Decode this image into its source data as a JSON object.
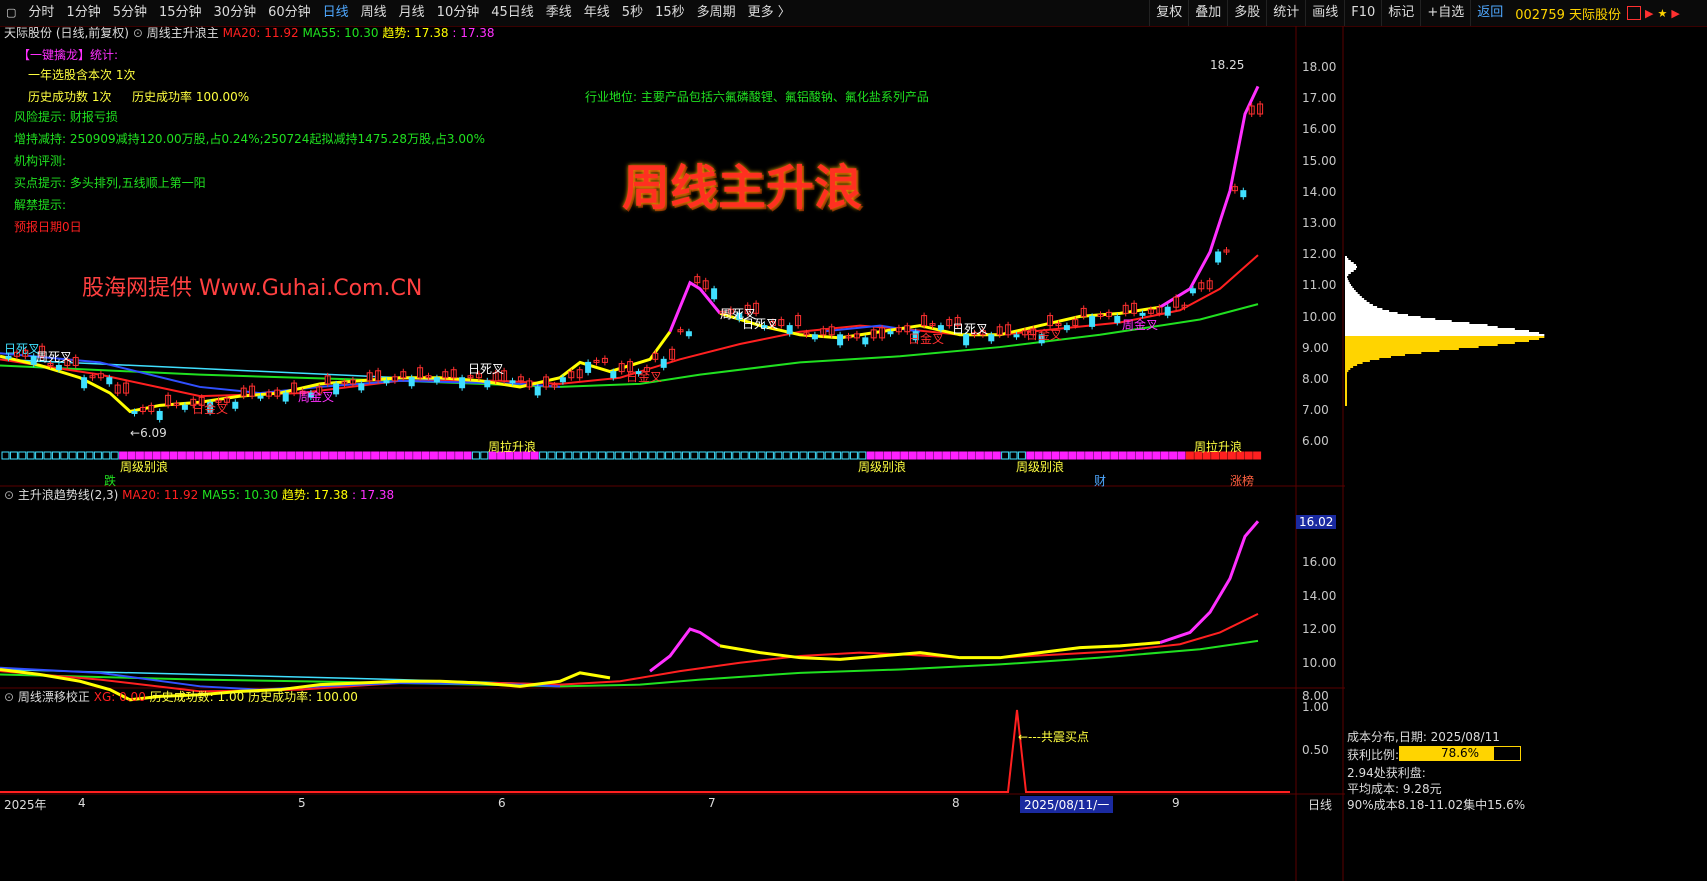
{
  "toolbar": {
    "periods": [
      "分时",
      "1分钟",
      "5分钟",
      "15分钟",
      "30分钟",
      "60分钟",
      "日线",
      "周线",
      "月线",
      "10分钟",
      "45日线",
      "季线",
      "年线",
      "5秒",
      "15秒",
      "多周期",
      "更多 〉"
    ],
    "active_period": "日线",
    "right_buttons": [
      "复权",
      "叠加",
      "多股",
      "统计",
      "画线",
      "F10",
      "标记",
      "+自选",
      "返回"
    ],
    "stock_title": "002759 天际股份"
  },
  "main_panel": {
    "header": {
      "stock": "天际股份 (日线,前复权)",
      "indicator_name": "周线主升浪主",
      "ma20_label": "MA20: 11.92",
      "ma55_label": "MA55: 10.30",
      "trend_label": "趋势: 17.38",
      "trend2_label": ": 17.38"
    },
    "stats": {
      "title": "【一键擒龙】统计:",
      "line1": "一年选股含本次 1次",
      "line2a": "历史成功数 1次",
      "line2b": "历史成功率 100.00%",
      "risk": "风险提示: 财报亏损",
      "holding": "增持减持: 250909减持120.00万股,占0.24%;250724起拟减持1475.28万股,占3.00%",
      "rating": "机构评测:",
      "buy_hint": "买点提示: 多头排列,五线顺上第一阳",
      "unlock": "解禁提示:",
      "report": "预报日期0日"
    },
    "industry": "行业地位: 主要产品包括六氟磷酸锂、氟铝酸钠、氟化盐系列产品",
    "big_title": "周线主升浪",
    "watermark": "股海网提供 Www.Guhai.Com.CN",
    "annotations": {
      "high": "18.25",
      "low": "6.09",
      "death_cross_day": "日死叉",
      "death_cross_week": "周死叉",
      "golden_cross_day": "日金叉",
      "golden_cross_week": "周金叉",
      "week_rally": "周拉升浪",
      "week_farewell": "周级别浪",
      "fall": "跌",
      "finance": "财",
      "limit_list": "涨榜"
    },
    "y_axis": [
      "18.00",
      "17.00",
      "16.00",
      "15.00",
      "14.00",
      "13.00",
      "12.00",
      "11.00",
      "10.00",
      "9.00",
      "8.00",
      "7.00",
      "6.00"
    ]
  },
  "sub_panel": {
    "header": {
      "name": "主升浪趋势线(2,3)",
      "ma20_label": "MA20: 11.92",
      "ma55_label": "MA55: 10.30",
      "trend_label": "趋势: 17.38",
      "trend2_label": ": 17.38"
    },
    "y_axis": [
      "16.00",
      "14.00",
      "12.00",
      "10.00",
      "8.00"
    ],
    "current_value": "16.02"
  },
  "bottom_panel": {
    "header": {
      "name": "周线漂移校正",
      "xg_label": "XG: 0.00",
      "succ_label": "历史成功数: 1.00",
      "rate_label": "历史成功率: 100.00"
    },
    "annotation": "←---共震买点",
    "y_axis": [
      "1.00",
      "0.50"
    ]
  },
  "x_axis": {
    "labels": [
      "2025年",
      "4",
      "5",
      "6",
      "7",
      "8",
      "9"
    ],
    "cursor_date": "2025/08/11/一",
    "period": "日线"
  },
  "chip_panel": {
    "date_line": "成本分布,日期: 2025/08/11",
    "profit_label": "获利比例:",
    "profit_value": "78.6%",
    "profit_ratio": 0.786,
    "profit_point": "2.94处获利盘:",
    "avg_cost": "平均成本: 9.28元",
    "concentration": "90%成本8.18-11.02集中15.6%"
  },
  "colors": {
    "ma20": "#ff2020",
    "ma55": "#20e020",
    "trend": "#ffff00",
    "trend2": "#ff30ff",
    "blue": "#3050ff",
    "cyan": "#40e0ff"
  }
}
